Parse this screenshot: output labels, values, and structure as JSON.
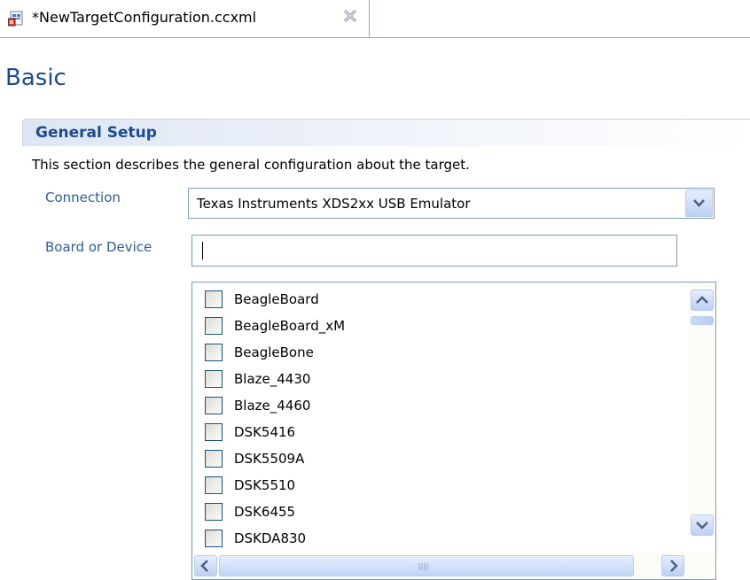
{
  "tab": {
    "title": "*NewTargetConfiguration.ccxml",
    "icon": "target-config-file-icon",
    "close_icon": "close-icon"
  },
  "page": {
    "title": "Basic"
  },
  "section": {
    "title": "General Setup",
    "description": "This section describes the general configuration about the target."
  },
  "connection": {
    "label": "Connection",
    "value": "Texas Instruments XDS2xx USB Emulator"
  },
  "board": {
    "label": "Board or Device",
    "value": ""
  },
  "device_list": [
    {
      "label": "BeagleBoard",
      "checked": false
    },
    {
      "label": "BeagleBoard_xM",
      "checked": false
    },
    {
      "label": "BeagleBone",
      "checked": false
    },
    {
      "label": "Blaze_4430",
      "checked": false
    },
    {
      "label": "Blaze_4460",
      "checked": false
    },
    {
      "label": "DSK5416",
      "checked": false
    },
    {
      "label": "DSK5509A",
      "checked": false
    },
    {
      "label": "DSK5510",
      "checked": false
    },
    {
      "label": "DSK6455",
      "checked": false
    },
    {
      "label": "DSKDA830",
      "checked": false
    }
  ],
  "colors": {
    "accent": "#2a5ca8",
    "title": "#1d4a8f",
    "border": "#7f9db9"
  }
}
